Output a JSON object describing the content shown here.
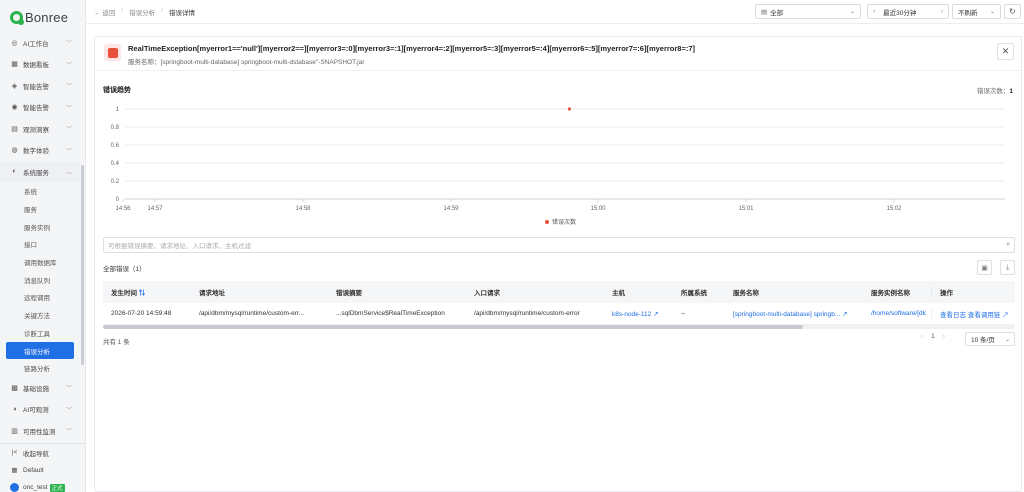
{
  "app": {
    "logo_text": "Bonree"
  },
  "sidebar": {
    "items": [
      {
        "label": "AI工作台",
        "icon": "ai-icon"
      },
      {
        "label": "数据看板",
        "icon": "dashboard-icon"
      },
      {
        "label": "智能告警",
        "icon": "alert-icon"
      },
      {
        "label": "智能告警",
        "icon": "monitor-icon"
      },
      {
        "label": "观测洞察",
        "icon": "insight-icon"
      },
      {
        "label": "数字体验",
        "icon": "experience-icon"
      },
      {
        "label": "系统服务",
        "icon": "service-icon"
      }
    ],
    "sub_items": [
      "系统",
      "服务",
      "服务实例",
      "接口",
      "调用数据库",
      "消息队列",
      "远程调用",
      "关键方法",
      "诊断工具",
      "错误分析",
      "链路分析"
    ],
    "items_after": [
      {
        "label": "基础设施",
        "icon": "infra-icon"
      },
      {
        "label": "AI可观测",
        "icon": "ai-observe-icon"
      },
      {
        "label": "可用性监测",
        "icon": "availability-icon"
      }
    ],
    "bottom": {
      "collapse": "收起导航",
      "workspace": "Default",
      "user": "onc_test",
      "user_badge": "正式"
    }
  },
  "topbar": {
    "breadcrumb": [
      "返回",
      "错误分析",
      "错误详情"
    ],
    "scope": "全部",
    "time_range": "最近30分钟",
    "refresh": "不刷新"
  },
  "detail": {
    "title": "RealTimeException[myerror1=='null'][myerror2==][myerror3=:0][myerror3=:1][myerror4=:2][myerror5=:3][myerror5=:4][myerror6=:5][myerror7=:6][myerror8=:7]",
    "service": "服务名称：[springboot-multi-database] springboot-multi-dstabase\"-SNAPSHOT.jar"
  },
  "trend": {
    "title": "错误趋势",
    "count_label": "错误次数：",
    "count_value": "1"
  },
  "chart_data": {
    "type": "scatter",
    "x_labels": [
      "14:56",
      "14:57",
      "14:58",
      "14:59",
      "15:00",
      "15:01",
      "15:02"
    ],
    "y_ticks": [
      "0",
      "0.2",
      "0.4",
      "0.6",
      "0.8",
      "1"
    ],
    "ylim": [
      0,
      1
    ],
    "series": [
      {
        "name": "错误次数",
        "color": "#e8503c",
        "points": [
          {
            "x": "14:59:48",
            "y": 1
          }
        ]
      }
    ],
    "legend_position": "bottom",
    "grid": true
  },
  "search": {
    "placeholder": "可根据错误摘要、请求地址、入口请求、主机过滤"
  },
  "list": {
    "title": "全部错误（1）",
    "columns": [
      "发生时间",
      "请求地址",
      "错误摘要",
      "入口请求",
      "主机",
      "所属系统",
      "服务名称",
      "服务实例名称",
      "操作"
    ],
    "rows": [
      {
        "time": "2026-07-20 14:59:48",
        "url": "/api/dbm/mysql/runtime/custom-err...",
        "summary": "...sqlDbmService$RealTimeException",
        "entry": "/api/dbm/mysql/runtime/custom-error",
        "host": "k8s-node-112",
        "system": "--",
        "service": "[springboot-multi-database] springb...",
        "instance": "/home/software/[dk",
        "action_log": "查看日志",
        "action_chain": "查看调用链"
      }
    ],
    "total": "共有 1 条",
    "page": "1",
    "page_size": "10 条/页"
  }
}
